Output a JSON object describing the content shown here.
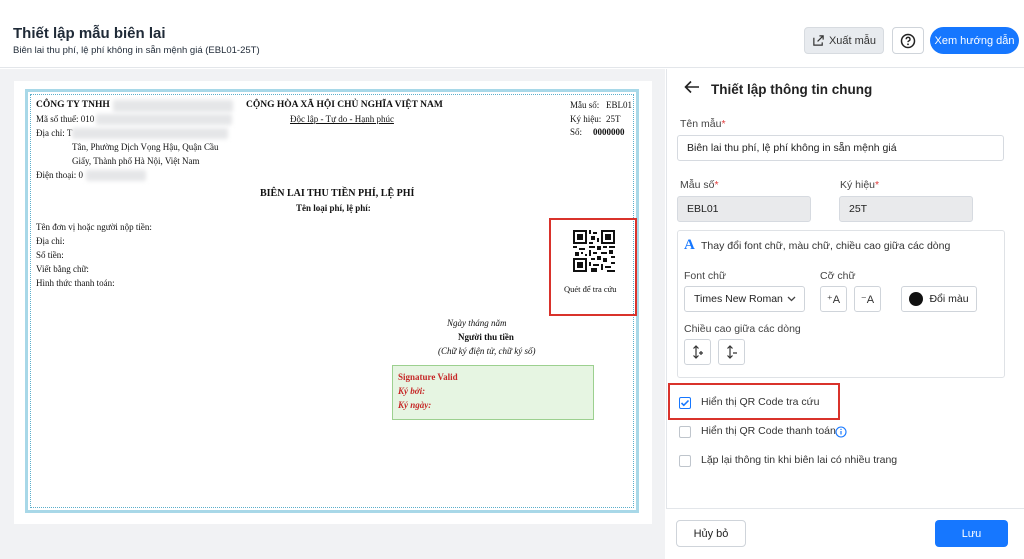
{
  "header": {
    "title": "Thiết lập mẫu biên lai",
    "subtitle": "Biên lai thu phí, lệ phí không in sẵn mệnh giá (EBL01-25T)",
    "export_label": "Xuất mẫu",
    "help_icon": "question-circle-icon",
    "guide_label": "Xem hướng dẫn"
  },
  "receipt": {
    "company": "CÔNG TY TNHH",
    "tax_code_label": "Mã số thuế: 010",
    "address_label": "Địa chỉ: T",
    "address_line2": "Tân, Phường Dịch Vọng Hậu, Quận Cầu",
    "address_line3": "Giấy, Thành phố Hà Nội, Việt Nam",
    "phone_label": "Điện thoại: 0",
    "nation": "CỘNG HÒA XÃ HỘI CHỦ NGHĨA VIỆT NAM",
    "motto": "Độc lập - Tự do - Hạnh phúc",
    "form_no": "Mẫu số:",
    "form_no_value": "EBL01",
    "symbol": "Ký hiệu:",
    "symbol_value": "25T",
    "number": "Số:",
    "number_value": "0000000",
    "title": "BIÊN LAI THU TIỀN PHÍ, LỆ PHÍ",
    "fee_type": "Tên loại phí, lệ phí:",
    "payer": "Tên đơn vị hoặc người nộp tiền:",
    "payer_address": "Địa chỉ:",
    "amount": "Số tiền:",
    "amount_words": "Viết bằng chữ:",
    "payment_method": "Hình thức thanh toán:",
    "qr_caption": "Quét để tra cứu",
    "date_line": "Ngày      tháng      năm",
    "collector": "Người thu tiền",
    "collector_note": "(Chữ ký điện tử, chữ ký số)",
    "sig_valid": "Signature Valid",
    "signed_by": "Ký bởi:",
    "signed_date": "Ký ngày:"
  },
  "panel": {
    "back_icon": "arrow-left-icon",
    "title": "Thiết lập thông tin chung",
    "template_name_label": "Tên mẫu",
    "template_name_value": "Biên lai thu phí, lệ phí không in sẵn mệnh giá",
    "form_no_label": "Mẫu số",
    "form_no_value": "EBL01",
    "symbol_label": "Ký hiệu",
    "symbol_value": "25T",
    "font_section_label": "Thay đổi font chữ, màu chữ, chiều cao giữa các dòng",
    "font_label": "Font chữ",
    "font_value": "Times New Roman",
    "size_label": "Cỡ chữ",
    "color_label": "Đổi màu",
    "line_height_label": "Chiều cao giữa các dòng",
    "required_mark": "*",
    "options": [
      {
        "label": "Hiển thị QR Code tra cứu",
        "checked": true
      },
      {
        "label": "Hiển thị QR Code thanh toán",
        "checked": false
      },
      {
        "label": "Lặp lại thông tin khi biên lai có nhiều trang",
        "checked": false
      }
    ],
    "cancel_label": "Hủy bỏ",
    "save_label": "Lưu"
  },
  "colors": {
    "primary": "#1677ff",
    "highlight": "#d9322b",
    "signature": "#c62828"
  }
}
